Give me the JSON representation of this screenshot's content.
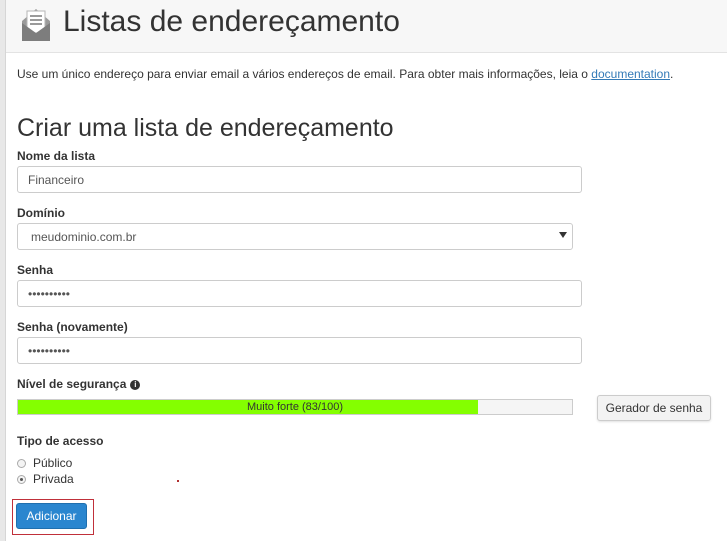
{
  "header": {
    "title": "Listas de endereçamento",
    "icon": "mailing-list-envelope-icon"
  },
  "intro": {
    "text": "Use um único endereço para enviar email a vários endereços de email. Para obter mais informações, leia o ",
    "link_text": "documentation",
    "suffix": "."
  },
  "form": {
    "title": "Criar uma lista de endereçamento",
    "list_name": {
      "label": "Nome da lista",
      "value": "Financeiro"
    },
    "domain": {
      "label": "Domínio",
      "value": "meudominio.com.br"
    },
    "password": {
      "label": "Senha",
      "value": "••••••••••"
    },
    "password_again": {
      "label": "Senha (novamente)",
      "value": "••••••••••"
    },
    "strength": {
      "label": "Nível de segurança",
      "text": "Muito forte (83/100)",
      "value": 83,
      "max": 100,
      "bar_color": "#84ff00"
    },
    "generator_button": "Gerador de senha",
    "access": {
      "label": "Tipo de acesso",
      "options": [
        {
          "label": "Público",
          "checked": false
        },
        {
          "label": "Privada",
          "checked": true
        }
      ]
    },
    "submit": "Adicionar"
  },
  "colors": {
    "primary": "#2a86cf",
    "link": "#337ab7",
    "highlight": "#c0303a"
  }
}
